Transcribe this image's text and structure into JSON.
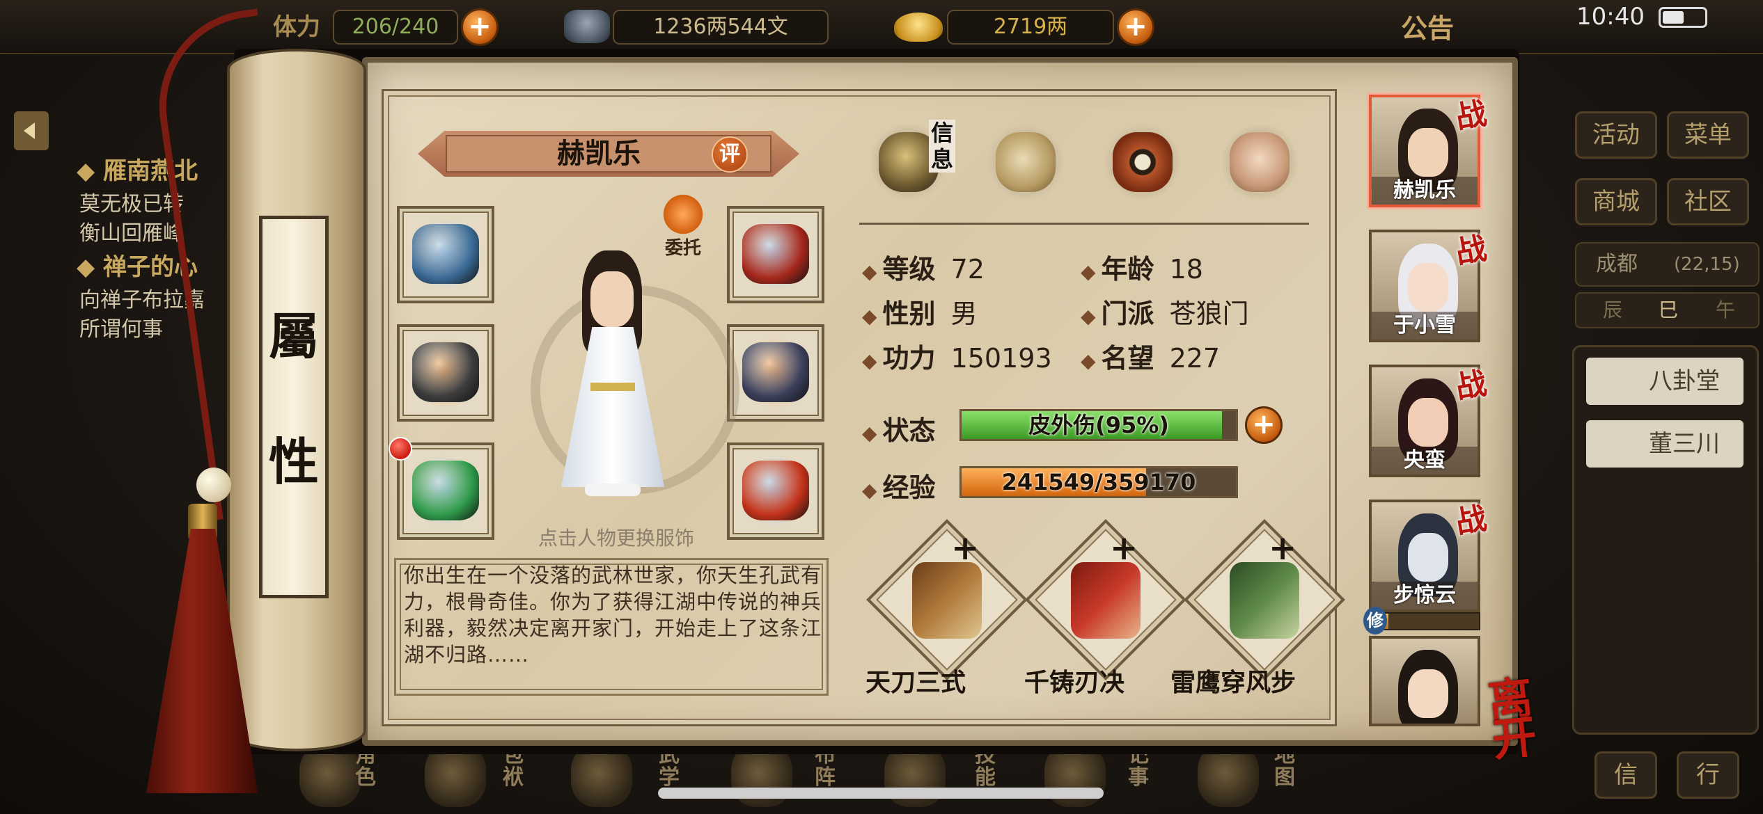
{
  "status_bar": {
    "time": "10:40"
  },
  "hud": {
    "stamina_label": "体力",
    "stamina": "206/240",
    "money": "1236两544文",
    "gold": "2719两",
    "notice": "公告"
  },
  "quests": [
    {
      "title": "雁南燕北",
      "desc": [
        "莫无极已转",
        "衡山回雁峰"
      ]
    },
    {
      "title": "禅子的心",
      "desc": [
        "向禅子布拉嘉",
        "所谓何事"
      ]
    }
  ],
  "right_menu": {
    "buttons": [
      "活动",
      "菜单",
      "商城",
      "社区"
    ],
    "location": "成都",
    "coords": "(22,15)",
    "time_slots": [
      "辰",
      "巳",
      "午"
    ],
    "npcs": [
      "八卦堂",
      "董三川"
    ],
    "bottom_buttons": [
      "信",
      "行"
    ]
  },
  "bottom_nav": [
    "角色",
    "包袱",
    "武学",
    "布阵",
    "技能",
    "记事",
    "地图"
  ],
  "scroll_title": [
    "屬",
    "性"
  ],
  "character": {
    "name": "赫凯乐",
    "rate_label": "评",
    "entrust_label": "委托",
    "change_outfit_hint": "点击人物更换服饰",
    "bio": "你出生在一个没落的武林世家，你天生孔武有力，根骨奇佳。你为了获得江湖中传说的神兵利器，毅然决定离开家门，开始走上了这条江湖不归路……"
  },
  "equipment": [
    {
      "slot": "gloves",
      "icon": "gauntlet-icon",
      "color": "#3a6a96",
      "halo": "#9bc3e6"
    },
    {
      "slot": "belt",
      "icon": "belt-icon",
      "color": "#a4271c",
      "halo": "#9bc3e6"
    },
    {
      "slot": "weapon",
      "icon": "cleaver-icon",
      "color": "#3c3c3c",
      "halo": "#f19a4a"
    },
    {
      "slot": "armor",
      "icon": "armor-icon",
      "color": "#3b3f5a",
      "halo": "#f19a4a"
    },
    {
      "slot": "ring",
      "icon": "ring-icon",
      "color": "#2e9a4a",
      "halo": "#9bc3e6"
    },
    {
      "slot": "accessory",
      "icon": "pendant-icon",
      "color": "#c2321a",
      "halo": "#9bc3e6"
    }
  ],
  "tabs": [
    {
      "name": "info",
      "label": "信息",
      "icon": "portrait-icon"
    },
    {
      "name": "scroll",
      "icon": "scroll-icon"
    },
    {
      "name": "bagua",
      "icon": "bagua-icon"
    },
    {
      "name": "body",
      "icon": "muscle-icon"
    }
  ],
  "stats": {
    "level_label": "等级",
    "level": "72",
    "age_label": "年龄",
    "age": "18",
    "gender_label": "性别",
    "gender": "男",
    "sect_label": "门派",
    "sect": "苍狼门",
    "power_label": "功力",
    "power": "150193",
    "fame_label": "名望",
    "fame": "227",
    "status_label": "状态",
    "status_text": "皮外伤(95%)",
    "status_fraction": 0.95,
    "exp_label": "经验",
    "exp_text": "241549/359170",
    "exp_fraction": 0.6725
  },
  "skills": [
    {
      "name": "天刀三式",
      "icon": "book-icon",
      "color": "#8b5a2b"
    },
    {
      "name": "千铸刃决",
      "icon": "scroll-red-icon",
      "color": "#b8321c"
    },
    {
      "name": "雷鹰穿风步",
      "icon": "scroll-green-icon",
      "color": "#4a7a3a"
    }
  ],
  "party": [
    {
      "name": "赫凯乐",
      "badge": "战",
      "hair": "#2a1d15",
      "face": "#f0d3b6",
      "active": true
    },
    {
      "name": "于小雪",
      "badge": "战",
      "hair": "#e9e9ee",
      "face": "#f6dccb",
      "active": false
    },
    {
      "name": "央蛮",
      "badge": "战",
      "hair": "#2c1616",
      "face": "#f1cdb6",
      "active": false
    },
    {
      "name": "步惊云",
      "badge": "战",
      "hair": "#2b3240",
      "face": "#dfe3ea",
      "active": false
    },
    {
      "name": "",
      "badge": "修",
      "hair": "#1f1712",
      "face": "#f3d8c2",
      "active": false
    }
  ],
  "leave_label": "离开",
  "colors": {
    "health_bar": "#4fb83a",
    "exp_bar": "#e87a1c",
    "accent_red": "#b8140e"
  }
}
